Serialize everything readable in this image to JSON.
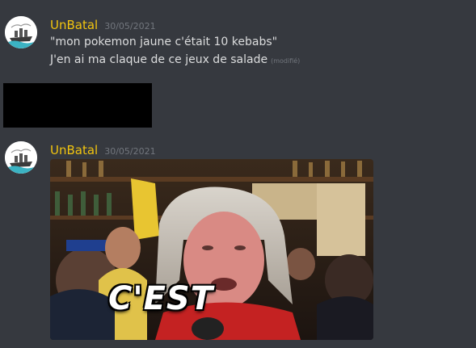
{
  "messages": [
    {
      "author": "UnBatal",
      "timestamp": "30/05/2021",
      "lines": [
        "\"mon pokemon jaune c'était 10 kebabs\"",
        "J'en ai ma claque de ce jeux de salade"
      ],
      "edited_label": "(modifié)"
    },
    {
      "author": "UnBatal",
      "timestamp": "30/05/2021",
      "gif_caption": "C'EST"
    }
  ],
  "colors": {
    "background": "#36393f",
    "author": "#f1c40f",
    "text": "#dcddde",
    "muted": "#72767d"
  },
  "icons": [
    "avatar-ship-icon"
  ]
}
